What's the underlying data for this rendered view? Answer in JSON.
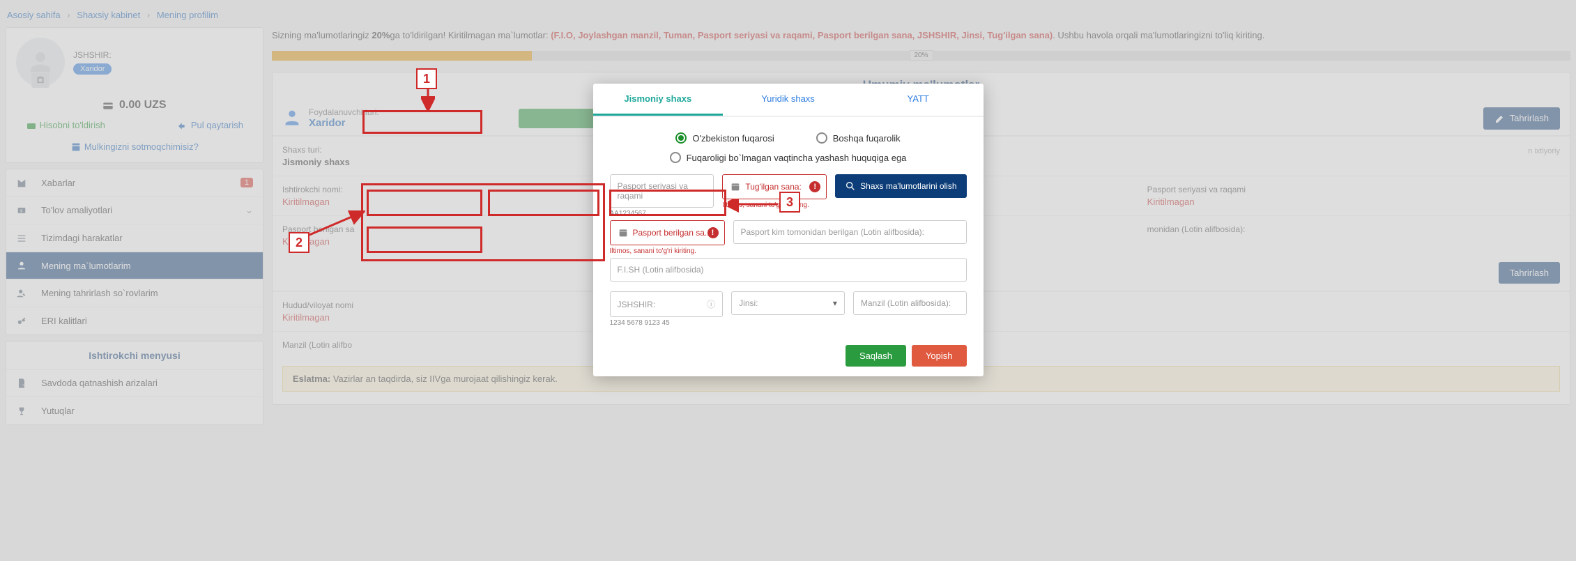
{
  "breadcrumb": {
    "home": "Asosiy sahifa",
    "cabinet": "Shaxsiy kabinet",
    "profile": "Mening profilim"
  },
  "sidebar": {
    "jshshir_label": "JSHSHIR:",
    "role_badge": "Xaridor",
    "balance": "0.00 UZS",
    "topup": "Hisobni to'ldirish",
    "refund": "Pul qaytarish",
    "sell": "Mulkingizni sotmoqchimisiz?",
    "menu": [
      {
        "label": "Xabarlar",
        "badge": "1"
      },
      {
        "label": "To'lov amaliyotlari"
      },
      {
        "label": "Tizimdagi harakatlar"
      },
      {
        "label": "Mening ma`lumotlarim"
      },
      {
        "label": "Mening tahrirlash so`rovlarim"
      },
      {
        "label": "ERI kalitlari"
      }
    ],
    "section2_title": "Ishtirokchi menyusi",
    "menu2": [
      {
        "label": "Savdoda qatnashish arizalari"
      },
      {
        "label": "Yutuqlar"
      }
    ]
  },
  "banner": {
    "p1": "Sizning ma'lumotlaringiz ",
    "pct": "20%",
    "p2": "ga to'ldirilgan! Kiritilmagan ma`lumotlar: ",
    "missing": "(F.I.O, Joylashgan manzil, Tuman, Pasport seriyasi va raqami, Pasport berilgan sana, JSHSHIR, Jinsi, Tug'ilgan sana)",
    "p3": ". Ushbu havola orqali ma'lumotlaringizni to'liq kiriting.",
    "progress": "20%"
  },
  "section": {
    "title": "Umumiy ma'lumotlar",
    "user_label": "Foydalanuvchi turi:",
    "user_value": "Xaridor",
    "edit": "Tahrirlash",
    "edit2": "Tahrirlash",
    "fields": {
      "shaxs_l": "Shaxs turi:",
      "shaxs_v": "Jismoniy shaxs",
      "ishtirokchi_l": "Ishtirokchi nomi:",
      "ishtirokchi_v": "Kiritilmagan",
      "pberilgan_l": "Pasport berilgan sa",
      "pberilgan_v": "Kiritilmagan",
      "hudud_l": "Hudud/viloyat nomi",
      "hudud_v": "Kiritilmagan",
      "manzil_l": "Manzil (Lotin alifbo",
      "opt": "n ixtiyoriy",
      "pasport_l": "Pasport seriyasi va raqami",
      "pasport_v": "Kiritilmagan",
      "kim_l": "monidan (Lotin alifbosida):"
    },
    "warning_label": "Eslatma: ",
    "warning": "Vazirlar                                                                                                                                an taqdirda, siz IIVga murojaat qilishingiz kerak."
  },
  "modal": {
    "tabs": {
      "t1": "Jismoniy shaxs",
      "t2": "Yuridik shaxs",
      "t3": "YATT"
    },
    "radios": {
      "r1": "O'zbekiston fuqarosi",
      "r2": "Boshqa fuqarolik",
      "r3": "Fuqaroligi bo`lmagan vaqtincha yashash huquqiga ega"
    },
    "passport_ph": "Pasport seriyasi va raqami",
    "passport_hint": "AA1234567",
    "birth_ph": "Tug'ilgan sana:",
    "birth_err": "Iltimos, sanani to'g'ri kiriting.",
    "issued_ph": "Pasport berilgan sa...",
    "issued_err": "Iltimos, sanani to'g'ri kiriting.",
    "issuedby_ph": "Pasport kim tomonidan berilgan (Lotin alifbosida):",
    "fish_ph": "F.I.SH (Lotin alifbosida)",
    "jshshir_ph": "JSHSHIR:",
    "jshshir_hint": "1234 5678 9123 45",
    "jinsi_ph": "Jinsi:",
    "manzil_ph": "Manzil (Lotin alifbosida):",
    "get_btn": "Shaxs ma'lumotlarini olish",
    "save": "Saqlash",
    "close": "Yopish"
  },
  "anno": {
    "n1": "1",
    "n2": "2",
    "n3": "3"
  }
}
